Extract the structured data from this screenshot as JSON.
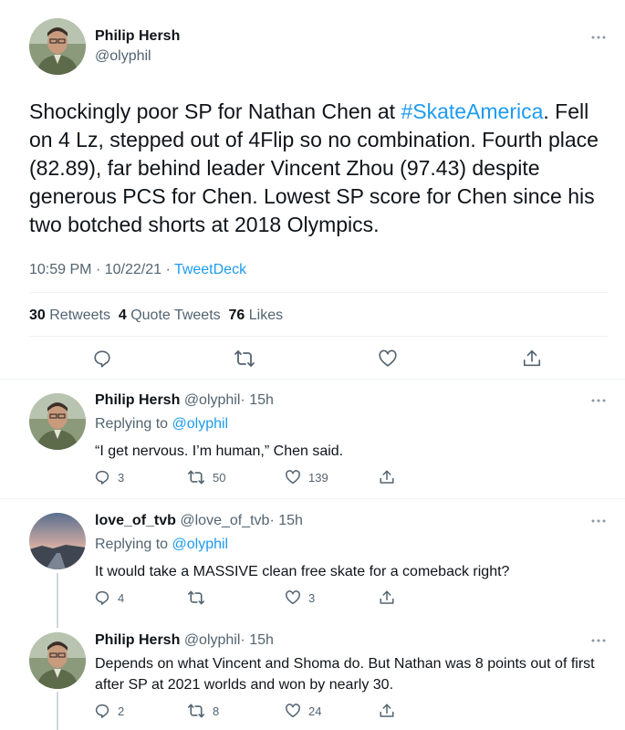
{
  "main_tweet": {
    "author_name": "Philip Hersh",
    "author_handle": "@olyphil",
    "text_before_tag": "Shockingly poor SP for Nathan Chen at ",
    "hashtag": "#SkateAmerica",
    "text_after_tag": ". Fell on 4 Lz, stepped out of 4Flip so no combination.  Fourth place (82.89), far behind leader Vincent Zhou (97.43) despite generous PCS for Chen.  Lowest SP score for Chen since his two botched shorts at 2018 Olympics.",
    "time": "10:59 PM",
    "date": "10/22/21",
    "separator": "·",
    "source": "TweetDeck",
    "stats": {
      "retweets_count": "30",
      "retweets_label": "Retweets",
      "quotes_count": "4",
      "quotes_label": "Quote Tweets",
      "likes_count": "76",
      "likes_label": "Likes"
    }
  },
  "replies": [
    {
      "author_name": "Philip Hersh",
      "author_handle": "@olyphil",
      "time_ago": "· 15h",
      "replying_label": "Replying to",
      "replying_to": "@olyphil",
      "text": "“I get nervous.  I’m human,” Chen said.",
      "reply_count": "3",
      "retweet_count": "50",
      "like_count": "139"
    },
    {
      "author_name": "love_of_tvb",
      "author_handle": "@love_of_tvb",
      "time_ago": "· 15h",
      "replying_label": "Replying to",
      "replying_to": "@olyphil",
      "text": "It would take a MASSIVE clean free skate for a comeback right?",
      "reply_count": "4",
      "retweet_count": "",
      "like_count": "3"
    },
    {
      "author_name": "Philip Hersh",
      "author_handle": "@olyphil",
      "time_ago": "· 15h",
      "text": "Depends on what Vincent and Shoma do.  But Nathan was 8 points out of first after SP at 2021 worlds and won by nearly 30.",
      "reply_count": "2",
      "retweet_count": "8",
      "like_count": "24"
    }
  ],
  "icons": {
    "reply": "reply-bubble-icon",
    "retweet": "retweet-arrows-icon",
    "like": "heart-icon",
    "share": "share-upload-icon",
    "more": "more-dots-icon"
  },
  "colors": {
    "link": "#1d9bf0",
    "muted": "#536471",
    "text": "#0f1419",
    "divider": "#eff3f4",
    "thread_line": "#cfd9de"
  }
}
